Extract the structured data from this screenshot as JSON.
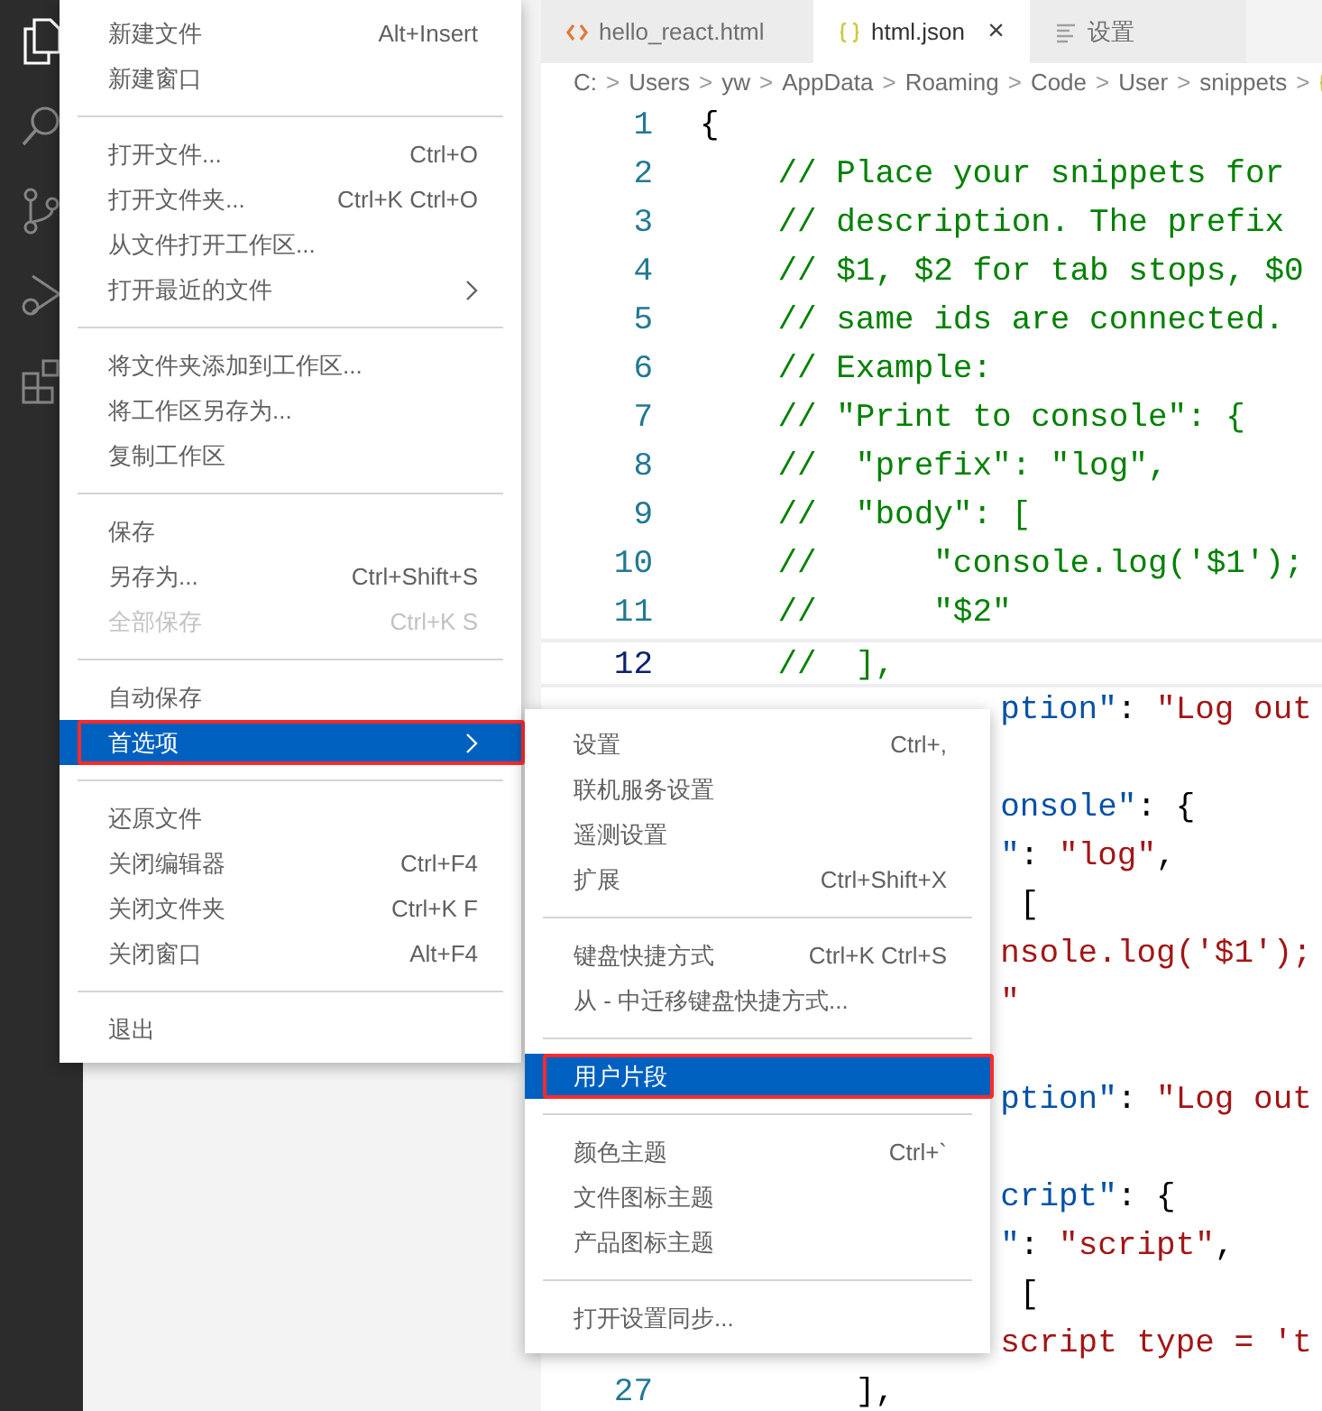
{
  "tabs": [
    {
      "label": "hello_react.html",
      "kind": "html",
      "selected": false,
      "closable": false
    },
    {
      "label": "html.json",
      "kind": "json",
      "selected": true,
      "closable": true
    },
    {
      "label": "设置",
      "kind": "settings",
      "selected": false,
      "closable": false
    }
  ],
  "close_glyph": "×",
  "breadcrumb": [
    "C:",
    "Users",
    "yw",
    "AppData",
    "Roaming",
    "Code",
    "User",
    "snippets"
  ],
  "breadcrumb_separator": ">",
  "code_lines": [
    {
      "kind": "full",
      "number": "1",
      "current": false,
      "tokens": [
        {
          "t": "{",
          "kind": "punct"
        }
      ]
    },
    {
      "kind": "full",
      "number": "2",
      "current": false,
      "tokens": [
        {
          "t": "    // Place your snippets for",
          "kind": "comment"
        }
      ]
    },
    {
      "kind": "full",
      "number": "3",
      "current": false,
      "tokens": [
        {
          "t": "    // description. The prefix",
          "kind": "comment"
        }
      ]
    },
    {
      "kind": "full",
      "number": "4",
      "current": false,
      "tokens": [
        {
          "t": "    // $1, $2 for tab stops, $0",
          "kind": "comment"
        }
      ]
    },
    {
      "kind": "full",
      "number": "5",
      "current": false,
      "tokens": [
        {
          "t": "    // same ids are connected.",
          "kind": "comment"
        }
      ]
    },
    {
      "kind": "full",
      "number": "6",
      "current": false,
      "tokens": [
        {
          "t": "    // Example:",
          "kind": "comment"
        }
      ]
    },
    {
      "kind": "full",
      "number": "7",
      "current": false,
      "tokens": [
        {
          "t": "    // \"Print to console\": {",
          "kind": "comment"
        }
      ]
    },
    {
      "kind": "full",
      "number": "8",
      "current": false,
      "tokens": [
        {
          "t": "    //  \"prefix\": \"log\",",
          "kind": "comment"
        }
      ]
    },
    {
      "kind": "full",
      "number": "9",
      "current": false,
      "tokens": [
        {
          "t": "    //  \"body\": [",
          "kind": "comment"
        }
      ]
    },
    {
      "kind": "full",
      "number": "10",
      "current": false,
      "tokens": [
        {
          "t": "    //      \"console.log('$1');",
          "kind": "comment"
        }
      ]
    },
    {
      "kind": "full",
      "number": "11",
      "current": false,
      "tokens": [
        {
          "t": "    //      \"$2\"",
          "kind": "comment"
        }
      ]
    },
    {
      "kind": "full",
      "number": "12",
      "current": true,
      "tokens": [
        {
          "t": "    //  ],",
          "kind": "comment"
        }
      ]
    },
    {
      "kind": "partial",
      "tokens": [
        {
          "t": "  ption\"",
          "kind": "key"
        },
        {
          "t": ": ",
          "kind": "punct"
        },
        {
          "t": "\"Log out",
          "kind": "string"
        }
      ]
    },
    {
      "kind": "blank"
    },
    {
      "kind": "partial",
      "tokens": [
        {
          "t": "  onsole\"",
          "kind": "key"
        },
        {
          "t": ": {",
          "kind": "punct"
        }
      ]
    },
    {
      "kind": "partial",
      "tokens": [
        {
          "t": "  \"",
          "kind": "key"
        },
        {
          "t": ": ",
          "kind": "punct"
        },
        {
          "t": "\"log\"",
          "kind": "string"
        },
        {
          "t": ",",
          "kind": "punct"
        }
      ]
    },
    {
      "kind": "partial",
      "tokens": [
        {
          "t": "   [",
          "kind": "punct"
        }
      ]
    },
    {
      "kind": "partial",
      "tokens": [
        {
          "t": "  nsole.log('$1');",
          "kind": "string"
        }
      ]
    },
    {
      "kind": "partial",
      "tokens": [
        {
          "t": "  \"",
          "kind": "string"
        }
      ]
    },
    {
      "kind": "blank"
    },
    {
      "kind": "partial",
      "tokens": [
        {
          "t": "  ption\"",
          "kind": "key"
        },
        {
          "t": ": ",
          "kind": "punct"
        },
        {
          "t": "\"Log out",
          "kind": "string"
        }
      ]
    },
    {
      "kind": "blank"
    },
    {
      "kind": "partial",
      "tokens": [
        {
          "t": "  cript\"",
          "kind": "key"
        },
        {
          "t": ": {",
          "kind": "punct"
        }
      ]
    },
    {
      "kind": "partial",
      "tokens": [
        {
          "t": "  \"",
          "kind": "key"
        },
        {
          "t": ": ",
          "kind": "punct"
        },
        {
          "t": "\"script\"",
          "kind": "string"
        },
        {
          "t": ",",
          "kind": "punct"
        }
      ]
    },
    {
      "kind": "partial",
      "tokens": [
        {
          "t": "   [",
          "kind": "punct"
        }
      ]
    },
    {
      "kind": "partial",
      "tokens": [
        {
          "t": "  script type = 't",
          "kind": "string"
        }
      ]
    },
    {
      "kind": "full",
      "number": "27",
      "current": false,
      "tokens": [
        {
          "t": "        ],",
          "kind": "punct"
        }
      ]
    }
  ],
  "file_menu": {
    "groups": [
      [
        {
          "label": "新建文件",
          "shortcut": "Alt+Insert",
          "disabled": false,
          "submenu": false,
          "selected": false,
          "annotated": false
        },
        {
          "label": "新建窗口",
          "disabled": false,
          "submenu": false,
          "selected": false,
          "annotated": false
        }
      ],
      [
        {
          "label": "打开文件...",
          "shortcut": "Ctrl+O",
          "disabled": false,
          "submenu": false,
          "selected": false,
          "annotated": false
        },
        {
          "label": "打开文件夹...",
          "shortcut": "Ctrl+K Ctrl+O",
          "disabled": false,
          "submenu": false,
          "selected": false,
          "annotated": false
        },
        {
          "label": "从文件打开工作区...",
          "disabled": false,
          "submenu": false,
          "selected": false,
          "annotated": false
        },
        {
          "label": "打开最近的文件",
          "disabled": false,
          "submenu": true,
          "selected": false,
          "annotated": false
        }
      ],
      [
        {
          "label": "将文件夹添加到工作区...",
          "disabled": false,
          "submenu": false,
          "selected": false,
          "annotated": false
        },
        {
          "label": "将工作区另存为...",
          "disabled": false,
          "submenu": false,
          "selected": false,
          "annotated": false
        },
        {
          "label": "复制工作区",
          "disabled": false,
          "submenu": false,
          "selected": false,
          "annotated": false
        }
      ],
      [
        {
          "label": "保存",
          "disabled": false,
          "submenu": false,
          "selected": false,
          "annotated": false
        },
        {
          "label": "另存为...",
          "shortcut": "Ctrl+Shift+S",
          "disabled": false,
          "submenu": false,
          "selected": false,
          "annotated": false
        },
        {
          "label": "全部保存",
          "shortcut": "Ctrl+K S",
          "disabled": true,
          "submenu": false,
          "selected": false,
          "annotated": false
        }
      ],
      [
        {
          "label": "自动保存",
          "disabled": false,
          "submenu": false,
          "selected": false,
          "annotated": false
        },
        {
          "label": "首选项",
          "disabled": false,
          "submenu": true,
          "selected": true,
          "annotated": true
        }
      ],
      [
        {
          "label": "还原文件",
          "disabled": false,
          "submenu": false,
          "selected": false,
          "annotated": false
        },
        {
          "label": "关闭编辑器",
          "shortcut": "Ctrl+F4",
          "disabled": false,
          "submenu": false,
          "selected": false,
          "annotated": false
        },
        {
          "label": "关闭文件夹",
          "shortcut": "Ctrl+K F",
          "disabled": false,
          "submenu": false,
          "selected": false,
          "annotated": false
        },
        {
          "label": "关闭窗口",
          "shortcut": "Alt+F4",
          "disabled": false,
          "submenu": false,
          "selected": false,
          "annotated": false
        }
      ],
      [
        {
          "label": "退出",
          "disabled": false,
          "submenu": false,
          "selected": false,
          "annotated": false
        }
      ]
    ]
  },
  "preferences_submenu": {
    "groups": [
      [
        {
          "label": "设置",
          "shortcut": "Ctrl+,",
          "disabled": false,
          "submenu": false,
          "selected": false,
          "annotated": false
        },
        {
          "label": "联机服务设置",
          "disabled": false,
          "submenu": false,
          "selected": false,
          "annotated": false
        },
        {
          "label": "遥测设置",
          "disabled": false,
          "submenu": false,
          "selected": false,
          "annotated": false
        },
        {
          "label": "扩展",
          "shortcut": "Ctrl+Shift+X",
          "disabled": false,
          "submenu": false,
          "selected": false,
          "annotated": false
        }
      ],
      [
        {
          "label": "键盘快捷方式",
          "shortcut": "Ctrl+K Ctrl+S",
          "disabled": false,
          "submenu": false,
          "selected": false,
          "annotated": false
        },
        {
          "label": "从 - 中迁移键盘快捷方式...",
          "disabled": false,
          "submenu": false,
          "selected": false,
          "annotated": false
        }
      ],
      [
        {
          "label": "用户片段",
          "disabled": false,
          "submenu": false,
          "selected": true,
          "annotated": true
        }
      ],
      [
        {
          "label": "颜色主题",
          "shortcut": "Ctrl+`",
          "disabled": false,
          "submenu": false,
          "selected": false,
          "annotated": false
        },
        {
          "label": "文件图标主题",
          "disabled": false,
          "submenu": false,
          "selected": false,
          "annotated": false
        },
        {
          "label": "产品图标主题",
          "disabled": false,
          "submenu": false,
          "selected": false,
          "annotated": false
        }
      ],
      [
        {
          "label": "打开设置同步...",
          "disabled": false,
          "submenu": false,
          "selected": false,
          "annotated": false
        }
      ]
    ]
  }
}
